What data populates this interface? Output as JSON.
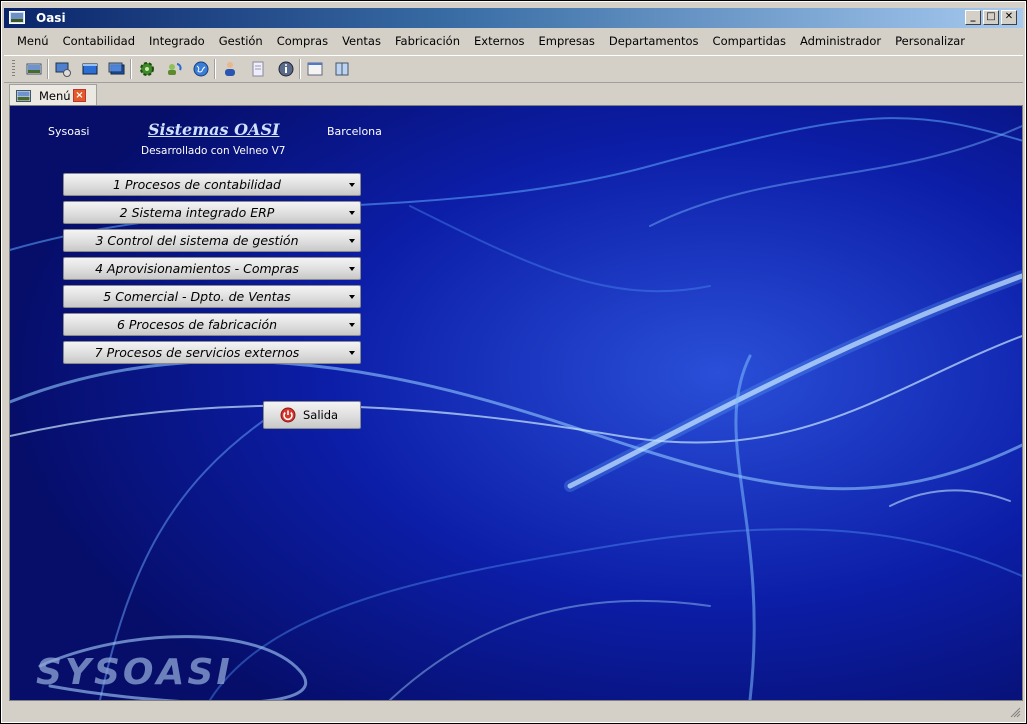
{
  "window": {
    "title": "Oasi",
    "minimize": "_",
    "maximize": "□",
    "close": "✕"
  },
  "menubar": [
    "Menú",
    "Contabilidad",
    "Integrado",
    "Gestión",
    "Compras",
    "Ventas",
    "Fabricación",
    "Externos",
    "Empresas",
    "Departamentos",
    "Compartidas",
    "Administrador",
    "Personalizar"
  ],
  "tab": {
    "label": "Menú",
    "close": "×"
  },
  "header": {
    "left": "Sysoasi",
    "title": "Sistemas OASI",
    "subtitle": "Desarrollado con Velneo V7",
    "right": "Barcelona"
  },
  "menu_buttons": [
    "1  Procesos de contabilidad",
    "2  Sistema integrado ERP",
    "3  Control del sistema de gestión",
    "4  Aprovisionamientos - Compras",
    "5  Comercial - Dpto. de Ventas",
    "6  Procesos de fabricación",
    "7  Procesos de servicios externos"
  ],
  "exit_button": {
    "label": "Salida"
  },
  "watermark": "SYSOASI",
  "colors": {
    "background": "#0a1a9a",
    "titlebar": "#0a246a",
    "accent": "#e55a2b"
  }
}
